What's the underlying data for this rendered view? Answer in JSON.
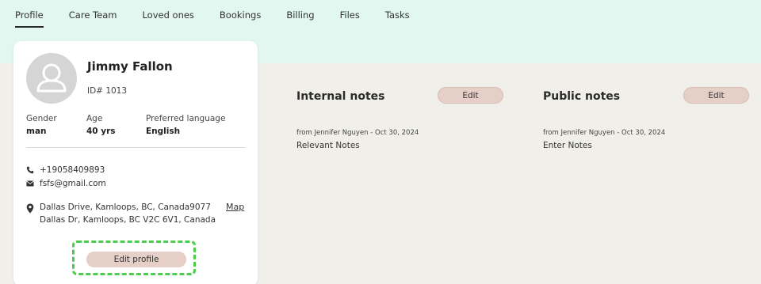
{
  "tabs": [
    {
      "label": "Profile",
      "active": true
    },
    {
      "label": "Care Team"
    },
    {
      "label": "Loved ones"
    },
    {
      "label": "Bookings"
    },
    {
      "label": "Billing"
    },
    {
      "label": "Files"
    },
    {
      "label": "Tasks"
    }
  ],
  "profile": {
    "name": "Jimmy Fallon",
    "id": "ID# 1013",
    "avatar_icon": "user-silhouette-icon",
    "gender_label": "Gender",
    "gender": "man",
    "age_label": "Age",
    "age": "40 yrs",
    "language_label": "Preferred language",
    "language": "English",
    "phone": "+19058409893",
    "email": "fsfs@gmail.com",
    "address_line1": "Dallas Drive, Kamloops, BC, Canada9077",
    "address_line2": "Dallas Dr, Kamloops, BC V2C 6V1, Canada",
    "map_label": "Map",
    "edit_label": "Edit profile"
  },
  "internal_notes": {
    "title": "Internal notes",
    "edit_label": "Edit",
    "from": "from Jennifer Nguyen - Oct 30, 2024",
    "body": "Relevant Notes"
  },
  "public_notes": {
    "title": "Public notes",
    "edit_label": "Edit",
    "from": "from Jennifer Nguyen - Oct 30, 2024",
    "body": "Enter Notes"
  },
  "colors": {
    "top_band": "#e1f7ef",
    "page_bg": "#f0efe9",
    "button_bg": "#e5cfc7",
    "highlight": "#4ccc4c"
  }
}
